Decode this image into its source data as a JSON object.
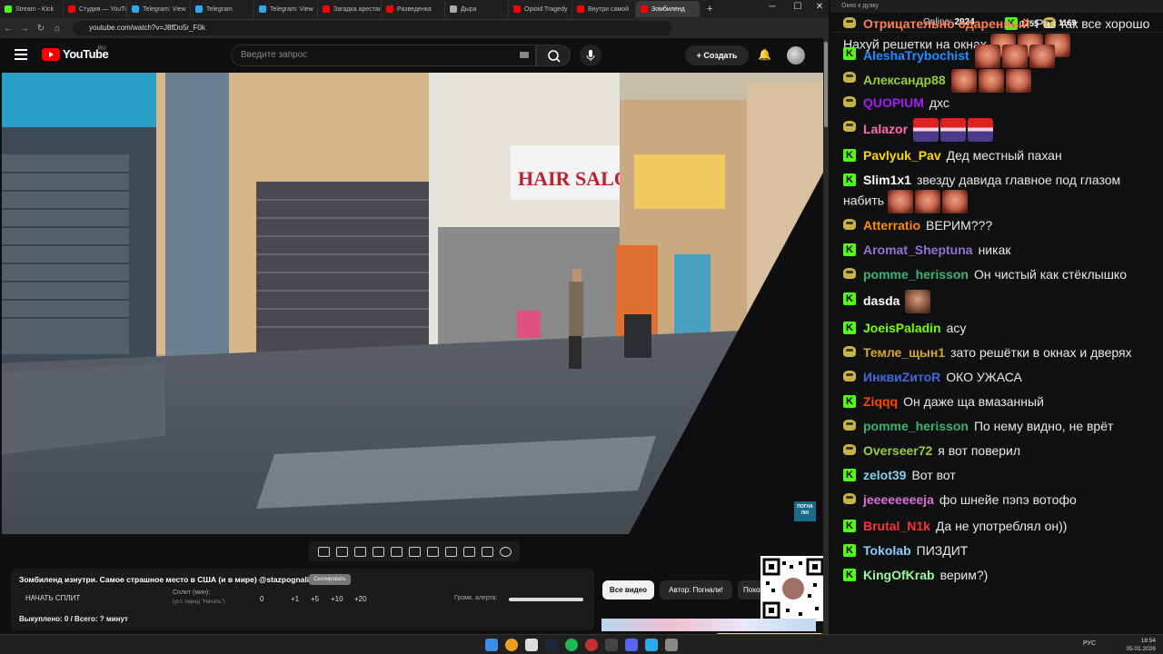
{
  "browser": {
    "tabs": [
      {
        "label": "Stream - Kick",
        "color": "#53fc18"
      },
      {
        "label": "Студия — YouTube",
        "color": "#ff0000"
      },
      {
        "label": "Telegram: View",
        "color": "#2aabee"
      },
      {
        "label": "Telegram",
        "color": "#2aabee"
      },
      {
        "label": "Telegram: View",
        "color": "#2aabee"
      },
      {
        "label": "Загадка арестанта",
        "color": "#ff0000"
      },
      {
        "label": "Разведенка",
        "color": "#ff0000"
      },
      {
        "label": "Дыра",
        "color": "#aaaaaa"
      },
      {
        "label": "Opioid Tragedy",
        "color": "#ff0000"
      },
      {
        "label": "Внутри самой",
        "color": "#ff0000"
      },
      {
        "label": "Зомбиленд",
        "color": "#ff0000"
      }
    ],
    "url": "youtube.com/watch?v=J8fDo5r_F0k",
    "new_tab": "+",
    "window_controls": {
      "minimize": "─",
      "maximize": "☐",
      "close": "✕"
    }
  },
  "youtube": {
    "logo_text": "YouTube",
    "region": "RU",
    "search_placeholder": "Введите запрос",
    "create_label": "+ Создать",
    "video_title": "Зомбиленд изнутри. Самое страшное место в США (и в мире) @stazpognali",
    "copy_button": "Скопировать",
    "watermark": "ПОГНА ЛИ!",
    "split_button": "НАЧАТЬ СПЛИТ",
    "split_label": "Сплит (мин):",
    "split_sub": "(уст. перед \"Начать\")",
    "split_value": "0",
    "increments": [
      "+1",
      "+5",
      "+10",
      "+20"
    ],
    "alert_label": "Громк. алерта:",
    "alert_volume": 1.0,
    "bought": "Выкуплено: 0 / Всего: ? минут",
    "chip_all": "Все видео",
    "chip_author": "Автор: Погнали!",
    "chip_similar": "Похожие"
  },
  "chat": {
    "window_title": "Окно к дуэку",
    "online_label": "Online:",
    "online_count": "2924",
    "kick_count": "1755",
    "twitch_count": "1169",
    "messages": [
      {
        "platform": "twitch",
        "nick": "Отрицательно одаренный",
        "color": "#ff7f50",
        "text": "Раз так все хорошо Нахуй решетки на окнах",
        "emotes": [
          "face",
          "face",
          "face"
        ]
      },
      {
        "platform": "kick",
        "nick": "AleshaTrybochist",
        "color": "#1e90ff",
        "text": "",
        "emotes": [
          "face",
          "face",
          "face"
        ]
      },
      {
        "platform": "twitch",
        "nick": "Александр88",
        "color": "#9acd32",
        "text": "",
        "emotes": [
          "face",
          "face",
          "face"
        ]
      },
      {
        "platform": "twitch",
        "nick": "QUOPIUM",
        "color": "#a020f0",
        "text": "дхс",
        "emotes": []
      },
      {
        "platform": "twitch",
        "nick": "Lalazor",
        "color": "#ff69b4",
        "text": "",
        "emotes": [
          "hat",
          "hat",
          "hat"
        ]
      },
      {
        "platform": "kick",
        "nick": "Pavlyuk_Pav",
        "color": "#ffd700",
        "text": "Дед местный пахан",
        "emotes": []
      },
      {
        "platform": "kick",
        "nick": "Slim1x1",
        "color": "#ffffff",
        "text": "звезду давида главное под глазом набить",
        "emotes": [
          "face",
          "face",
          "face"
        ]
      },
      {
        "platform": "twitch",
        "nick": "Atterratio",
        "color": "#ff8c00",
        "text": "ВЕРИМ???",
        "emotes": []
      },
      {
        "platform": "kick",
        "nick": "Aromat_Sheptuna",
        "color": "#9370db",
        "text": "никак",
        "emotes": []
      },
      {
        "platform": "twitch",
        "nick": "pomme_herisson",
        "color": "#3cb371",
        "text": "Он чистый как стёклышко",
        "emotes": []
      },
      {
        "platform": "kick",
        "nick": "dasda",
        "color": "#ffffff",
        "text": "",
        "emotes": [
          "guy"
        ]
      },
      {
        "platform": "kick",
        "nick": "JoeisPaladin",
        "color": "#7cfc00",
        "text": "асу",
        "emotes": []
      },
      {
        "platform": "twitch",
        "nick": "Темле_щын1",
        "color": "#daa520",
        "text": "зато решётки в окнах и дверях",
        "emotes": []
      },
      {
        "platform": "twitch",
        "nick": "ИнквиZитоR",
        "color": "#4169e1",
        "text": "ОКО УЖАСА",
        "emotes": []
      },
      {
        "platform": "kick",
        "nick": "Ziqqq",
        "color": "#ff4500",
        "text": "Он даже ща вмазанный",
        "emotes": []
      },
      {
        "platform": "twitch",
        "nick": "pomme_herisson",
        "color": "#3cb371",
        "text": "По нему видно, не врёт",
        "emotes": []
      },
      {
        "platform": "twitch",
        "nick": "Overseer72",
        "color": "#9acd32",
        "text": "я вот поверил",
        "emotes": []
      },
      {
        "platform": "kick",
        "nick": "zelot39",
        "color": "#87ceeb",
        "text": "Вот вот",
        "emotes": []
      },
      {
        "platform": "twitch",
        "nick": "jeeeeeeeeja",
        "color": "#da70d6",
        "text": "фо шнейе пэпэ вотофо",
        "emotes": []
      },
      {
        "platform": "kick",
        "nick": "Brutal_N1k",
        "color": "#ff3030",
        "text": "Да не употреблял он))",
        "emotes": []
      },
      {
        "platform": "kick",
        "nick": "Tokolab",
        "color": "#87cefa",
        "text": "ПИЗДИТ",
        "emotes": []
      },
      {
        "platform": "kick",
        "nick": "KingOfKrab",
        "color": "#98fb98",
        "text": "верим?)",
        "emotes": []
      }
    ]
  },
  "taskbar": {
    "lang": "РУС",
    "time": "18:54",
    "date": "05.01.2026"
  }
}
